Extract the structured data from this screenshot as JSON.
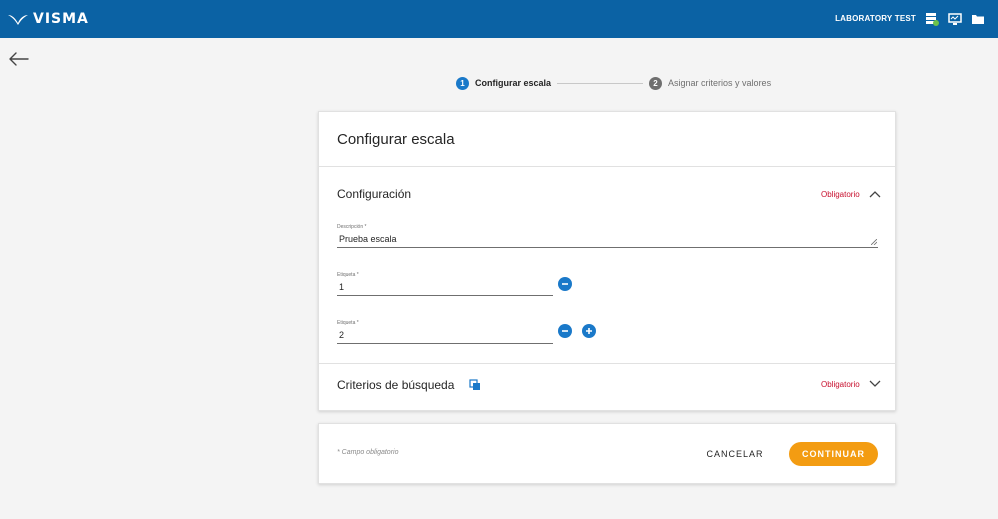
{
  "header": {
    "logo_text": "VISMA",
    "user_label": "LABORATORY TEST",
    "icons": [
      "database-settings-icon",
      "monitor-icon",
      "folder-icon"
    ],
    "bg_color": "#0b62a4"
  },
  "stepper": {
    "steps": [
      {
        "number": "1",
        "label": "Configurar escala",
        "state": "active"
      },
      {
        "number": "2",
        "label": "Asignar criterios y valores",
        "state": "inactive"
      }
    ]
  },
  "card": {
    "title": "Configurar escala",
    "configuracion": {
      "title": "Configuración",
      "required_label": "Obligatorio",
      "description": {
        "label": "Descripción *",
        "value": "Prueba escala"
      },
      "labels": [
        {
          "label": "Etiqueta *",
          "value": "1"
        },
        {
          "label": "Etiqueta *",
          "value": "2"
        }
      ]
    },
    "criterios": {
      "title": "Criterios de búsqueda",
      "required_label": "Obligatorio"
    }
  },
  "footer": {
    "note": "* Campo obligatorio",
    "cancel_label": "CANCELAR",
    "continue_label": "CONTINUAR",
    "accent_color": "#f39c12"
  }
}
